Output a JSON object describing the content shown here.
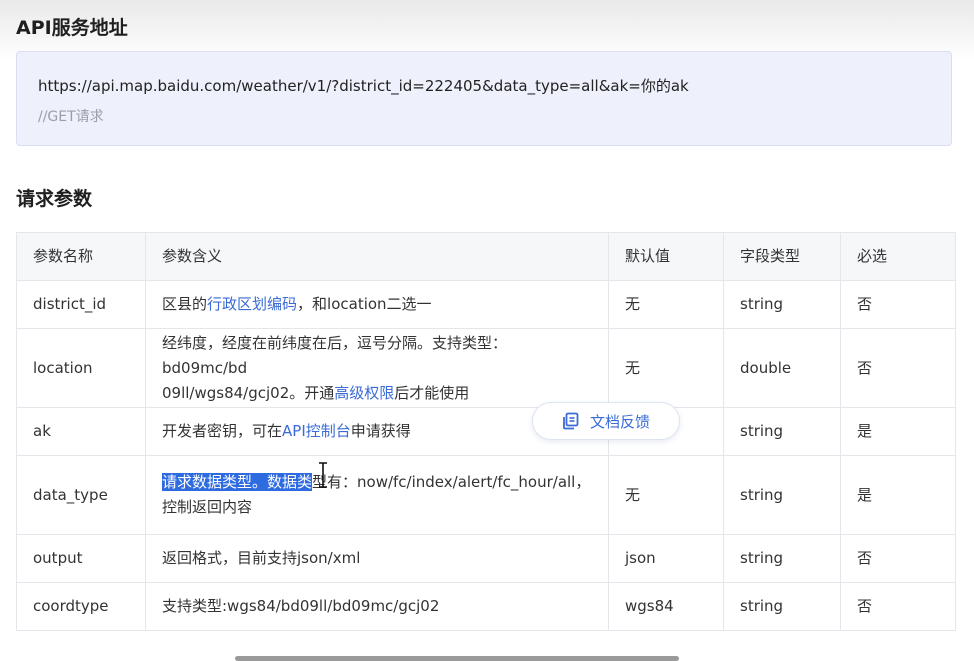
{
  "api_section": {
    "title": "API服务地址",
    "url": "https://api.map.baidu.com/weather/v1/?district_id=222405&data_type=all&ak=你的ak",
    "comment": "//GET请求"
  },
  "params_section": {
    "title": "请求参数",
    "headers": [
      "参数名称",
      "参数含义",
      "默认值",
      "字段类型",
      "必选"
    ],
    "rows": [
      {
        "name": "district_id",
        "desc": {
          "pre": "区县的",
          "link": "行政区划编码",
          "post": "，和location二选一"
        },
        "default": "无",
        "type": "string",
        "required": "否"
      },
      {
        "name": "location",
        "desc": {
          "line1": "经纬度，经度在前纬度在后，逗号分隔。支持类型：bd09mc/bd",
          "line2_pre": "09ll/wgs84/gcj02。开通",
          "link": "高级权限",
          "post": "后才能使用"
        },
        "default": "无",
        "type": "double",
        "required": "否"
      },
      {
        "name": "ak",
        "desc": {
          "pre": "开发者密钥，可在",
          "link": "API控制台",
          "post": "申请获得"
        },
        "default": "",
        "type": "string",
        "required": "是"
      },
      {
        "name": "data_type",
        "desc": {
          "highlight": "请求数据类型。数据类",
          "line1_rest": "型有：now/fc/index/alert/fc_hour/all，",
          "line2": "控制返回内容"
        },
        "default": "无",
        "type": "string",
        "required": "是"
      },
      {
        "name": "output",
        "desc": {
          "text": "返回格式，目前支持json/xml"
        },
        "default": "json",
        "type": "string",
        "required": "否"
      },
      {
        "name": "coordtype",
        "desc": {
          "text": "支持类型:wgs84/bd09ll/bd09mc/gcj02"
        },
        "default": "wgs84",
        "type": "string",
        "required": "否"
      }
    ]
  },
  "feedback": {
    "label": "文档反馈",
    "icon": "document-copy-icon"
  },
  "colors": {
    "link": "#3a6bd6",
    "highlight": "#2f6be0",
    "code_bg": "#eef1fb"
  }
}
